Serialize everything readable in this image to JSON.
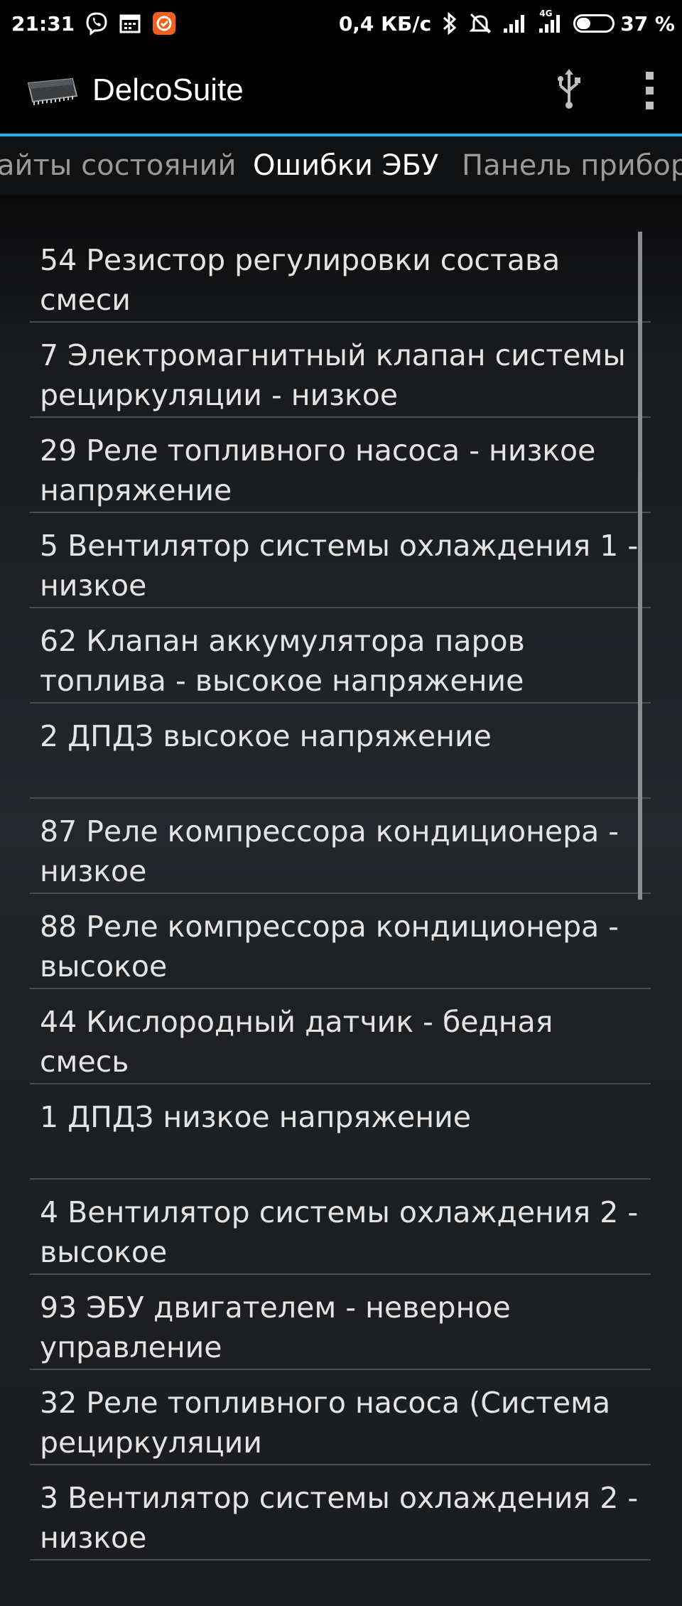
{
  "status_bar": {
    "time": "21:31",
    "speed": "0,4 КБ/с",
    "network_label": "4G",
    "battery": "37 %",
    "battery_level": 0.37,
    "icons": [
      "viber-icon",
      "calendar-icon",
      "app-notification-icon",
      "bluetooth-icon",
      "mute-icon",
      "signal-icon",
      "signal-4g-icon",
      "battery-icon"
    ]
  },
  "app_bar": {
    "title": "DelcoSuite",
    "logo_icon": "chip-icon",
    "usb_icon": "usb-icon",
    "menu_icon": "more-vert-icon",
    "accent_color": "#2ea9e6"
  },
  "tabs": [
    {
      "label": "айты состояний",
      "active": false
    },
    {
      "label": "Ошибки ЭБУ",
      "active": true
    },
    {
      "label": "Панель приборо",
      "active": false
    }
  ],
  "errors": [
    "54 Резистор регулировки состава смеси",
    "7 Электромагнитный клапан системы рециркуляции - низкое",
    "29 Реле топливного насоса - низкое напряжение",
    "5 Вентилятор системы охлаждения 1 - низкое",
    "62 Клапан аккумулятора паров топлива - высокое напряжение",
    "2 ДПДЗ высокое напряжение",
    "87 Реле компрессора кондиционера - низкое",
    "88 Реле компрессора кондиционера - высокое",
    "44 Кислородный датчик - бедная смесь",
    "1 ДПДЗ низкое напряжение",
    "4 Вентилятор системы охлаждения 2 - высокое",
    "93 ЭБУ двигателем - неверное управление",
    "32 Реле топливного насоса (Система рециркуляции",
    "3 Вентилятор системы охлаждения 2 - низкое"
  ]
}
